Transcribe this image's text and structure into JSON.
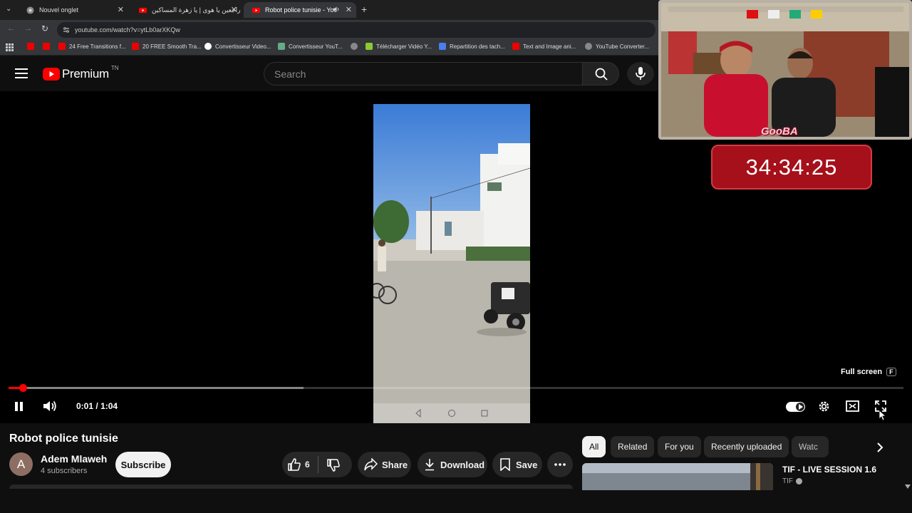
{
  "browser": {
    "tabs": [
      {
        "title": "Nouvel onglet",
        "active": false
      },
      {
        "title": "راجعين يا هوى | يا زهرة المساكين",
        "active": false
      },
      {
        "title": "Robot police tunisie - YouT",
        "active": true
      }
    ],
    "url": "youtube.com/watch?v=ytLb0arXKQw",
    "bookmarks": [
      "24 Free Transitions f...",
      "20 FREE Smooth Tra...",
      "Convertisseur Video...",
      "Convertisseur YouT...",
      "Télécharger Vidéo Y...",
      "Repartition des tach...",
      "Text and Image ani...",
      "YouTube Converter..."
    ]
  },
  "header": {
    "logo_text": "Premium",
    "region": "TN",
    "search_placeholder": "Search"
  },
  "player": {
    "time_current": "0:01",
    "time_total": "1:04",
    "time_separator": "/",
    "progress": 0.016,
    "buffered": 0.33,
    "tooltip_label": "Full screen",
    "tooltip_key": "F",
    "autoplay_on": true
  },
  "overlay": {
    "cam_label": "GooBA",
    "timer": "34:34:25"
  },
  "video_info": {
    "title": "Robot police tunisie",
    "channel_name": "Adem Mlaweh",
    "channel_initial": "A",
    "subscribers": "4 subscribers",
    "subscribe_label": "Subscribe",
    "like_count": "6",
    "share_label": "Share",
    "download_label": "Download",
    "save_label": "Save"
  },
  "chips": [
    "All",
    "Related",
    "For you",
    "Recently uploaded",
    "Watc"
  ],
  "recommended": [
    {
      "title": "TIF - LIVE SESSION 1.6",
      "channel": "TIF"
    }
  ],
  "colors": {
    "accent_red": "#ff0000",
    "timer_bg": "#a5101a",
    "background": "#0f0f0f"
  }
}
